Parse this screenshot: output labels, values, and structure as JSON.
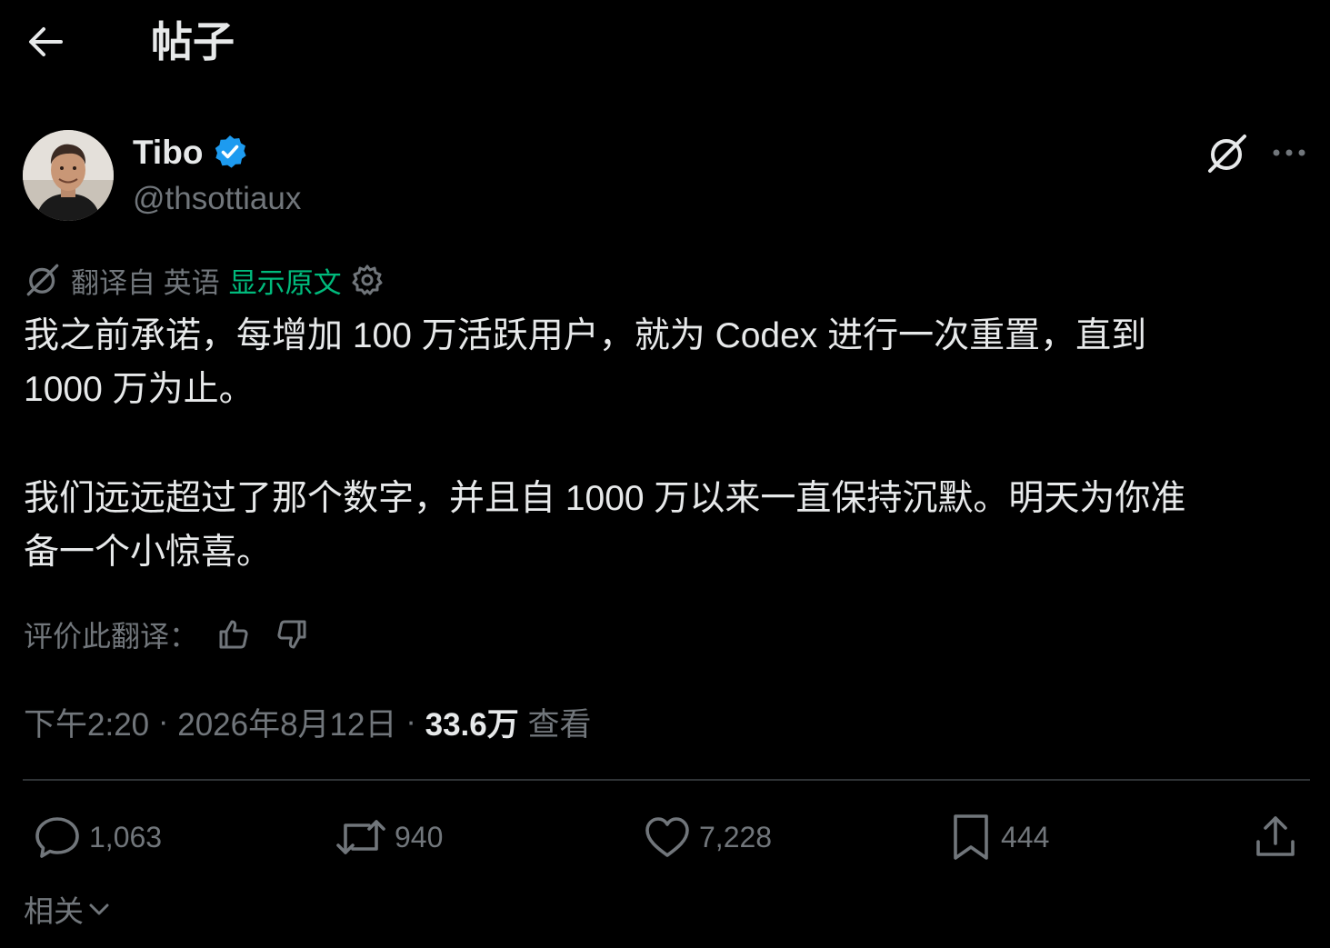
{
  "header": {
    "title": "帖子"
  },
  "author": {
    "name": "Tibo",
    "handle": "@thsottiaux"
  },
  "translation": {
    "label": "翻译自 英语",
    "show_original": "显示原文"
  },
  "tweet": {
    "paragraph_1": "我之前承诺，每增加 100 万活跃用户，就为 Codex 进行一次重置，直到\n1000 万为止。",
    "paragraph_2": "我们远远超过了那个数字，并且自 1000 万以来一直保持沉默。明天为你准\n备一个小惊喜。"
  },
  "rating": {
    "label": "评价此翻译："
  },
  "meta": {
    "time": "下午2:20",
    "separator": " · ",
    "date": "2026年8月12日",
    "views_count": "33.6万",
    "views_label": " 查看"
  },
  "actions": {
    "replies": "1,063",
    "reposts": "940",
    "likes": "7,228",
    "bookmarks": "444"
  },
  "related": {
    "label": "相关"
  },
  "colors": {
    "background": "#000000",
    "text": "#e7e9ea",
    "muted": "#71767b",
    "verified": "#1d9bf0",
    "show_original": "#00ba7c",
    "divider": "#2f3336"
  },
  "icons": [
    "back-arrow-icon",
    "verified-badge-icon",
    "grok-icon",
    "more-icon",
    "translate-icon",
    "settings-gear-icon",
    "thumbs-up-icon",
    "thumbs-down-icon",
    "reply-icon",
    "repost-icon",
    "like-icon",
    "bookmark-icon",
    "share-icon",
    "chevron-down-icon"
  ]
}
